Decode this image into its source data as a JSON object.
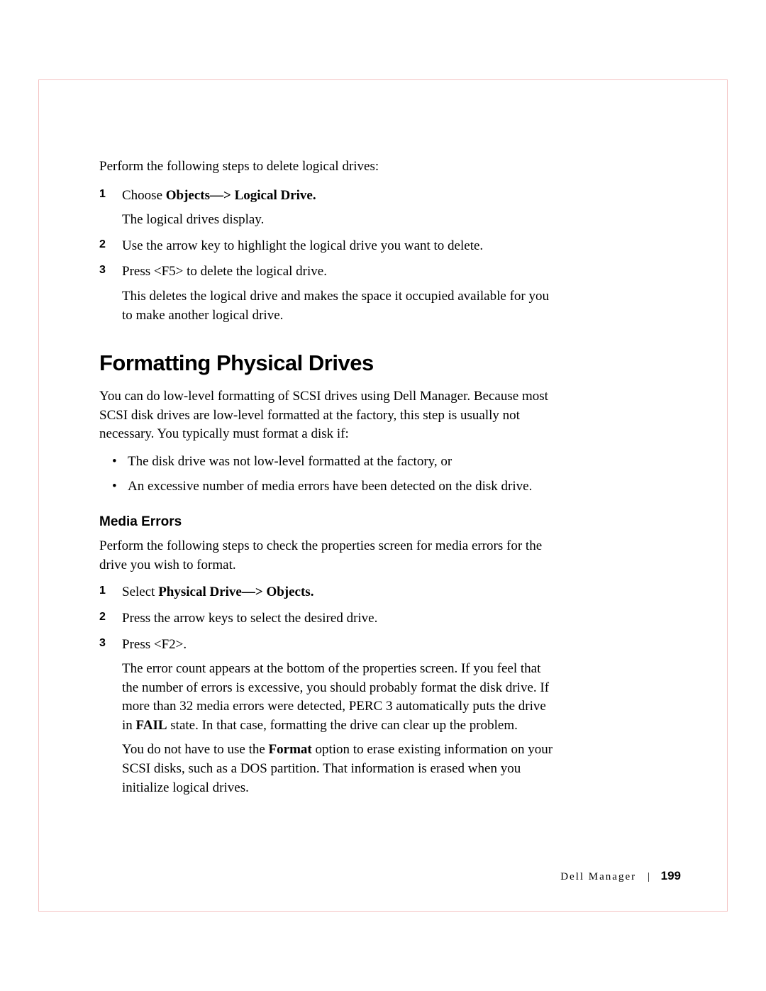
{
  "intro": "Perform the following steps to delete logical drives:",
  "steps1": [
    {
      "num": "1",
      "text_prefix": "Choose ",
      "text_bold": "Objects—> Logical Drive.",
      "sub": "The logical drives display."
    },
    {
      "num": "2",
      "text": "Use the arrow key to highlight the logical drive you want to delete."
    },
    {
      "num": "3",
      "text": "Press <F5> to delete the logical drive.",
      "sub": "This deletes the logical drive and makes the space it occupied available for you to make another logical drive."
    }
  ],
  "h1": "Formatting Physical Drives",
  "para1": "You can do low-level formatting of SCSI drives using Dell Manager. Because most SCSI disk drives are low-level formatted at the factory, this step is usually not necessary. You typically must format a disk if:",
  "bullets": [
    "The disk drive was not low-level formatted at the factory, or",
    "An excessive number of media errors have been detected on the disk drive."
  ],
  "h2": "Media Errors",
  "para2": "Perform the following steps to check the properties screen for media errors for the drive you wish to format.",
  "steps2": [
    {
      "num": "1",
      "text_prefix": "Select ",
      "text_bold": "Physical Drive—> Objects."
    },
    {
      "num": "2",
      "text": "Press the arrow keys to select the desired drive."
    },
    {
      "num": "3",
      "text": "Press <F2>.",
      "sub_pre1": "The error count appears at the bottom of the properties screen. If you feel that the number of errors is excessive, you should probably format the disk drive. If more than 32 media errors were detected, PERC 3 automatically puts the drive in ",
      "sub_bold1": "FAIL",
      "sub_post1": " state. In that case, formatting the drive can clear up the problem.",
      "sub_pre2": "You do not have to use the ",
      "sub_bold2": "Format",
      "sub_post2": " option to erase existing information on your SCSI disks, such as a DOS partition. That information is erased when you initialize logical drives."
    }
  ],
  "footer": {
    "section": "Dell Manager",
    "sep": "|",
    "page": "199"
  }
}
